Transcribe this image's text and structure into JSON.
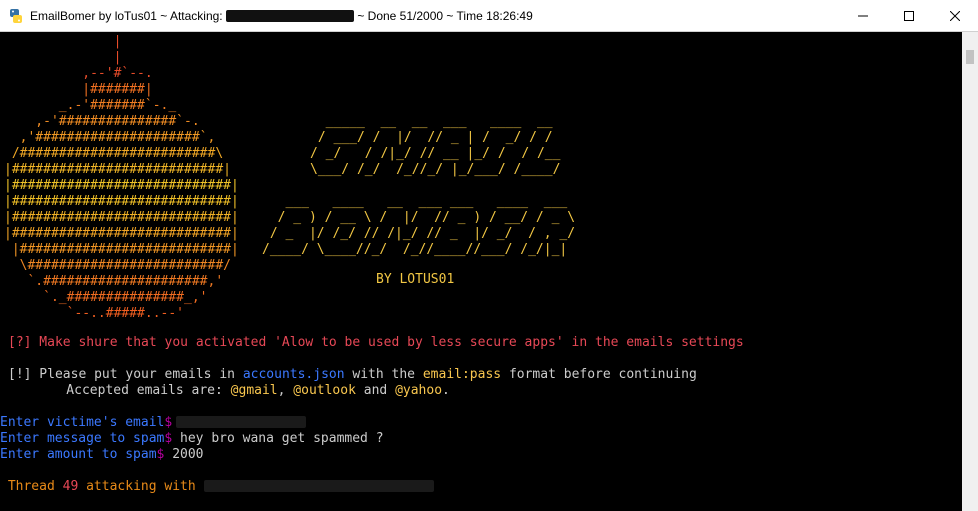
{
  "window": {
    "icon": "python-icon",
    "title_prefix": "EmailBomer by loTus01 ~ Attacking: ",
    "title_suffix": " ~ Done 51/2000 ~ Time 18:26:49",
    "controls": [
      "minimize-icon",
      "maximize-icon",
      "close-icon"
    ]
  },
  "ascii": {
    "ornament": "              |\n              |\n          ,--'#`--.\n          |#######|\n       _.-'#######`-._\n    ,-'###############`-.\n  ,'#####################`,\n /#########################\\\n|###########################|\n|############################|\n|############################|\n|############################|\n|############################|\n |###########################|\n  \\#########################/\n   `.#####################,'\n     `._###############_,'\n        `--..#####..--'",
    "logo_line1": "  _____  __  __  ___   ____  __\n / ___/ /  |/  // _ | /  _/ / /\n/ _/   / /|_/ // __ |_/ /  / /__\n\\___/ /_/  /_//_/ |_/___/ /____/",
    "logo_line2": "   ___   ____   __  ___ ___   ____  ___\n  / _ ) / __ \\ /  |/  // _ ) / __/ / _ \\\n / _  |/ /_/ // /|_/ // _  |/ _/  / , _/\n/____/ \\____//_/  /_//____//___/ /_/|_|",
    "byline": "BY LOTUS01"
  },
  "console": {
    "warning": "[?] Make shure that you activated 'Alow to be used by less secure apps' in the emails settings",
    "info_prefix": "[!] Please put your emails in ",
    "info_file": "accounts.json",
    "info_mid": " with the ",
    "info_format": "email:pass",
    "info_suffix": " format before continuing",
    "accepted_prefix": "    Accepted emails are: ",
    "accepted_gmail": "@gmail",
    "accepted_sep1": ", ",
    "accepted_outlook": "@outlook",
    "accepted_and": " and ",
    "accepted_yahoo": "@yahoo",
    "accepted_end": ".",
    "prompt_email": "Enter victime's email",
    "prompt_message": "Enter message to spam",
    "message_value": " hey bro wana get spammed ?",
    "prompt_amount": "Enter amount to spam",
    "amount_value": " 2000",
    "dollar": "$",
    "thread_prefix": " Thread ",
    "thread_number": "49",
    "thread_suffix": " attacking with "
  }
}
